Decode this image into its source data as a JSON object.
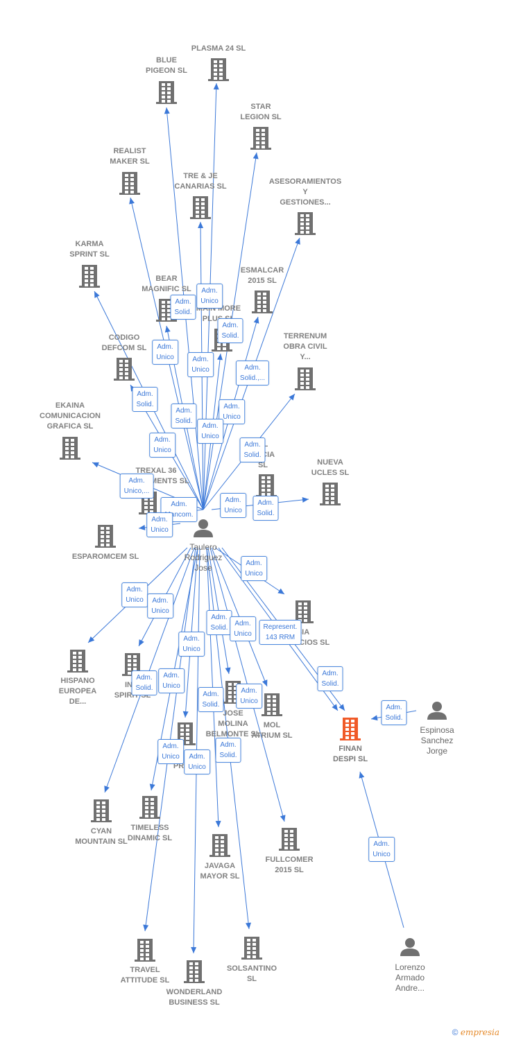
{
  "colors": {
    "edge": "#3b78d8",
    "building": "#707070",
    "highlight": "#f05a28",
    "person": "#707070"
  },
  "center": {
    "id": "taulero",
    "lines": [
      "Taulero",
      "Rodriguez",
      "Jose"
    ],
    "type": "person"
  },
  "nodes": [
    {
      "id": "plasma",
      "type": "company",
      "lines": [
        "PLASMA 24 SL"
      ]
    },
    {
      "id": "blue",
      "type": "company",
      "lines": [
        "BLUE",
        "PIGEON  SL"
      ]
    },
    {
      "id": "star",
      "type": "company",
      "lines": [
        "STAR",
        "LEGION  SL"
      ]
    },
    {
      "id": "realist",
      "type": "company",
      "lines": [
        "REALIST",
        "MAKER  SL"
      ]
    },
    {
      "id": "treje",
      "type": "company",
      "lines": [
        "TRE & JE",
        "CANARIAS  SL"
      ]
    },
    {
      "id": "asesor",
      "type": "company",
      "lines": [
        "ASESORAMIENTOS",
        "Y",
        "GESTIONES..."
      ]
    },
    {
      "id": "karma",
      "type": "company",
      "lines": [
        "KARMA",
        "SPRINT  SL"
      ]
    },
    {
      "id": "bear",
      "type": "company",
      "lines": [
        "BEAR",
        "MAGNIFIC  SL"
      ]
    },
    {
      "id": "esmalcar",
      "type": "company",
      "lines": [
        "ESMALCAR",
        "2015  SL"
      ]
    },
    {
      "id": "main",
      "type": "company",
      "lines": [
        "MAIN MORE",
        "PLUS  SL"
      ]
    },
    {
      "id": "codigo",
      "type": "company",
      "lines": [
        "CODIGO",
        "DEFCOM  SL"
      ]
    },
    {
      "id": "terrenum",
      "type": "company",
      "lines": [
        "TERRENUM",
        "OBRA CIVIL",
        "Y..."
      ]
    },
    {
      "id": "ekaina",
      "type": "company",
      "lines": [
        "EKAINA",
        "COMUNICACION",
        "GRAFICA  SL"
      ]
    },
    {
      "id": "encia",
      "type": "company",
      "lines": [
        "AL",
        "ENCIA",
        "SL"
      ]
    },
    {
      "id": "nueva",
      "type": "company",
      "lines": [
        "NUEVA",
        "UCLES  SL"
      ]
    },
    {
      "id": "trexal",
      "type": "company",
      "lines": [
        "TREXAL 36",
        "INVESTMENTS SL"
      ]
    },
    {
      "id": "esparomcem",
      "type": "company",
      "lines": [
        "ESPAROMCEM SL"
      ]
    },
    {
      "id": "sia",
      "type": "company",
      "lines": [
        "SIA",
        "NEGOCIOS  SL"
      ]
    },
    {
      "id": "hispano",
      "type": "company",
      "lines": [
        "HISPANO",
        "EUROPEA",
        "DE..."
      ]
    },
    {
      "id": "inic",
      "type": "company",
      "lines": [
        "INIC",
        "SPIRIT  SL"
      ]
    },
    {
      "id": "jose",
      "type": "company",
      "lines": [
        "JOSE",
        "MOLINA",
        "BELMONTE  SL"
      ]
    },
    {
      "id": "mol",
      "type": "company",
      "lines": [
        "MOL",
        "ATRIUM  SL"
      ]
    },
    {
      "id": "finan",
      "type": "company",
      "main": true,
      "lines": [
        "FINAN",
        "DESPI  SL"
      ]
    },
    {
      "id": "princ",
      "type": "company",
      "lines": [
        "PRINC"
      ]
    },
    {
      "id": "espinosa",
      "type": "person",
      "lines": [
        "Espinosa",
        "Sanchez",
        "Jorge"
      ]
    },
    {
      "id": "cyan",
      "type": "company",
      "lines": [
        "CYAN",
        "MOUNTAIN  SL"
      ]
    },
    {
      "id": "timeless",
      "type": "company",
      "lines": [
        "TIMELESS",
        "DINAMIC  SL"
      ]
    },
    {
      "id": "javaga",
      "type": "company",
      "lines": [
        "JAVAGA",
        "MAYOR  SL"
      ]
    },
    {
      "id": "fullcomer",
      "type": "company",
      "lines": [
        "FULLCOMER",
        "2015  SL"
      ]
    },
    {
      "id": "travel",
      "type": "company",
      "lines": [
        "TRAVEL",
        "ATTITUDE  SL"
      ]
    },
    {
      "id": "wonderland",
      "type": "company",
      "lines": [
        "WONDERLAND",
        "BUSINESS  SL"
      ]
    },
    {
      "id": "solsantino",
      "type": "company",
      "lines": [
        "SOLSANTINO",
        "SL"
      ]
    },
    {
      "id": "lorenzo",
      "type": "person",
      "lines": [
        "Lorenzo",
        "Armado",
        "Andre..."
      ]
    }
  ],
  "edge_labels": [
    [
      "Adm.",
      "Solid."
    ],
    [
      "Adm.",
      "Unico"
    ],
    [
      "Adm.",
      "Solid."
    ],
    [
      "Adm.",
      "Unico"
    ],
    [
      "Adm.",
      "Unico"
    ],
    [
      "Adm.",
      "Solid.,..."
    ],
    [
      "Adm.",
      "Solid."
    ],
    [
      "Adm.",
      "Solid."
    ],
    [
      "Adm.",
      "Unico"
    ],
    [
      "Adm.",
      "Unico"
    ],
    [
      "Adm.",
      "Unico"
    ],
    [
      "Adm.",
      "Solid."
    ],
    [
      "Adm.",
      "Unico,..."
    ],
    [
      "Adm.",
      "Mancom."
    ],
    [
      "Adm.",
      "Unico"
    ],
    [
      "Adm.",
      "Unico"
    ],
    [
      "Adm.",
      "Solid."
    ],
    [
      "Adm.",
      "Unico"
    ],
    [
      "Adm.",
      "Unico"
    ],
    [
      "Adm.",
      "Unico"
    ],
    [
      "Adm.",
      "Solid."
    ],
    [
      "Adm.",
      "Unico"
    ],
    [
      "Represent.",
      "143 RRM"
    ],
    [
      "Adm.",
      "Unico"
    ],
    [
      "Adm.",
      "Solid."
    ],
    [
      "Adm.",
      "Unico"
    ],
    [
      "Adm.",
      "Solid."
    ],
    [
      "Adm.",
      "Unico"
    ],
    [
      "Adm.",
      "Solid."
    ],
    [
      "Adm.",
      "Solid."
    ],
    [
      "Adm.",
      "Unico"
    ],
    [
      "Adm.",
      "Unico"
    ],
    [
      "Adm.",
      "Solid."
    ],
    [
      "Adm.",
      "Unico"
    ]
  ],
  "footer": {
    "copyright": "©",
    "brand": "empresia"
  }
}
